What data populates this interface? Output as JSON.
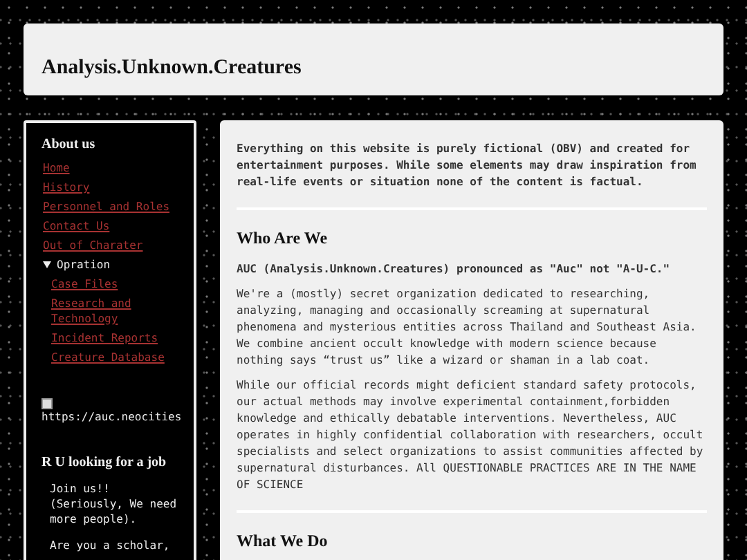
{
  "header": {
    "title": "Analysis.Unknown.Creatures"
  },
  "sidebar": {
    "heading": "About us",
    "links": [
      {
        "label": "Home"
      },
      {
        "label": "History"
      },
      {
        "label": "Personnel and Roles"
      },
      {
        "label": "Contact Us"
      },
      {
        "label": "Out of Charater"
      }
    ],
    "group": {
      "label": "Opration",
      "expanded": true,
      "links": [
        {
          "label": "Case Files"
        },
        {
          "label": "Research and Technology"
        },
        {
          "label": "Incident Reports"
        },
        {
          "label": "Creature Database"
        }
      ]
    },
    "image_alt": "https://auc.neocities",
    "job_heading": "R U looking for a job",
    "job_paragraphs": [
      "Join us!! (Seriously, We need more people).",
      "Are you a scholar,"
    ]
  },
  "main": {
    "disclaimer": "Everything on this website is purely fictional (OBV) and created for entertainment purposes. While some elements may draw inspiration from real-life events or situation none of the content is factual.",
    "sections": [
      {
        "heading": "Who Are We",
        "intro": "AUC (Analysis.Unknown.Creatures) pronounced as \"Auc\" not \"A-U-C.\"",
        "paragraphs": [
          "We're a (mostly) secret organization dedicated to researching, analyzing, managing and occasionally screaming at supernatural phenomena and mysterious entities across Thailand and Southeast Asia. We combine ancient occult knowledge with modern science because nothing says “trust us” like a wizard or shaman in a lab coat.",
          "While our official records might deficient standard safety protocols, our actual methods may involve experimental containment,forbidden knowledge and ethically debatable interventions. Nevertheless, AUC operates in highly confidential collaboration with researchers, occult specialists and select organizations to assist communities affected by supernatural disturbances. All QUESTIONABLE PRACTICES ARE IN THE NAME OF SCIENCE"
        ]
      },
      {
        "heading": "What We Do"
      }
    ]
  }
}
